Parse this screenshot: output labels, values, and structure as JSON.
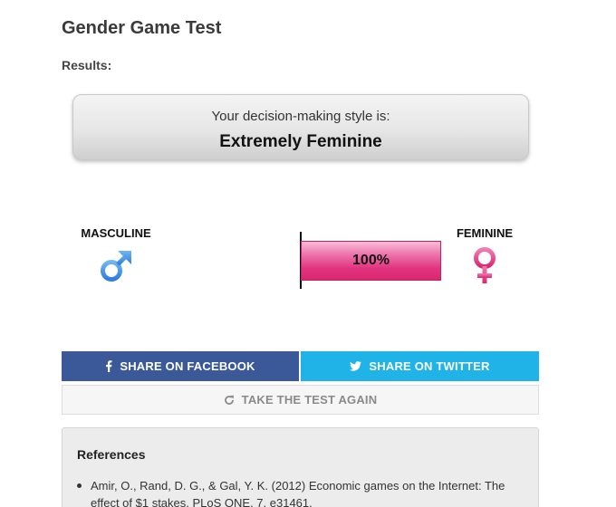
{
  "page": {
    "title": "Gender Game Test",
    "results_label": "Results:"
  },
  "result": {
    "intro": "Your decision-making style is:",
    "value": "Extremely Feminine"
  },
  "gauge": {
    "left_label": "MASCULINE",
    "right_label": "FEMININE",
    "left_icon": "male-symbol-icon",
    "right_icon": "female-symbol-icon",
    "percent_text": "100%",
    "fraction": 1.0,
    "direction": "feminine",
    "colors": {
      "fill": "#e1347f",
      "masculine": "#3a8ee6",
      "feminine": "#e1347f"
    }
  },
  "buttons": {
    "facebook": {
      "label": "SHARE ON FACEBOOK",
      "icon": "facebook-icon",
      "color": "#3b5998"
    },
    "twitter": {
      "label": "SHARE ON TWITTER",
      "icon": "twitter-icon",
      "color": "#1fb3e7"
    },
    "retake": {
      "label": "TAKE THE TEST AGAIN",
      "icon": "refresh-icon"
    }
  },
  "references": {
    "title": "References",
    "items": [
      "Amir, O., Rand, D. G., & Gal, Y. K. (2012) Economic games on the Internet: The effect of $1 stakes. PLoS ONE, 7, e31461."
    ]
  }
}
